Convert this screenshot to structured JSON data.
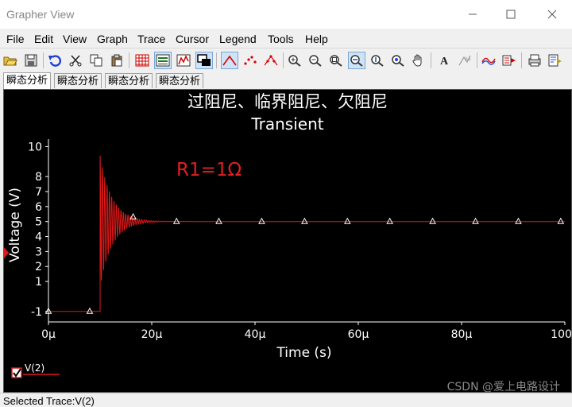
{
  "window": {
    "title": "Grapher View"
  },
  "menu": [
    "File",
    "Edit",
    "View",
    "Graph",
    "Trace",
    "Cursor",
    "Legend",
    "Tools",
    "Help"
  ],
  "toolbar_icons": [
    "open-icon",
    "save-icon",
    "undo-icon",
    "cut-icon",
    "copy-icon",
    "paste-icon",
    "grid-icon",
    "legend-icon",
    "stats-icon",
    "overlay-icon",
    "line-trace-icon",
    "scatter-trace-icon",
    "line-scatter-icon",
    "zoom-in-icon",
    "zoom-out-icon",
    "zoom-fit-icon",
    "zoom-x-icon",
    "zoom-y-icon",
    "zoom-area-icon",
    "pan-icon",
    "text-label-icon",
    "annotate-icon",
    "cursor-icon",
    "export-icon",
    "print-icon",
    "print-preview-icon"
  ],
  "tabs": [
    "瞬态分析",
    "瞬态分析",
    "瞬态分析",
    "瞬态分析"
  ],
  "graph": {
    "annotation": "R1=1Ω",
    "legend_label": "V(2)",
    "trace_color": "#e01818",
    "annotation_color": "#e02020"
  },
  "status": {
    "text": "Selected Trace:V(2)"
  },
  "watermark": "CSDN @爱上电路设计",
  "chart_data": {
    "type": "line",
    "title": "过阻尼、临界阻尼、欠阻尼",
    "subtitle": "Transient",
    "xlabel": "Time (s)",
    "ylabel": "Voltage (V)",
    "xlim": [
      0,
      100
    ],
    "ylim": [
      -1.7,
      10.5
    ],
    "x_unit": "μ",
    "x_ticks": [
      0,
      20,
      40,
      60,
      80,
      100
    ],
    "x_tick_labels": [
      "0μ",
      "20μ",
      "40μ",
      "60μ",
      "80μ",
      "100μ"
    ],
    "y_ticks": [
      -1,
      1,
      2,
      3,
      4,
      5,
      6,
      7,
      8,
      10
    ],
    "y_tick_labels": [
      "-1",
      "1",
      "2",
      "3",
      "4",
      "5",
      "6",
      "7",
      "8",
      "10"
    ],
    "grid": false,
    "series": [
      {
        "name": "V(2)",
        "step_time": 10,
        "initial_value": -1,
        "final_value": 5,
        "peak_value": 9.4,
        "oscillation_period": 0.45,
        "decay_time_constant": 2.3,
        "marker_x": [
          0,
          8,
          16.4,
          24.8,
          33,
          41.3,
          49.6,
          57.9,
          66.1,
          74.4,
          82.7,
          91,
          99.2
        ],
        "marker_y": [
          -1,
          -1,
          5.3,
          5,
          5,
          5,
          5,
          5,
          5,
          5,
          5,
          5,
          5
        ]
      }
    ]
  }
}
